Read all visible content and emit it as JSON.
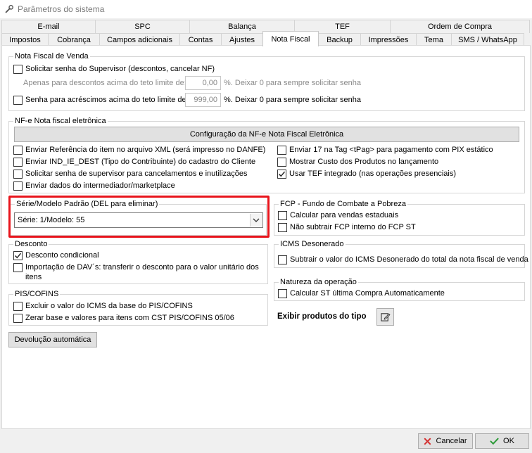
{
  "window": {
    "title": "Parâmetros do sistema"
  },
  "tabs_row1": [
    {
      "label": "E-mail"
    },
    {
      "label": "SPC"
    },
    {
      "label": "Balança"
    },
    {
      "label": "TEF"
    },
    {
      "label": "Ordem de Compra"
    }
  ],
  "tabs_row2": [
    {
      "label": "Impostos"
    },
    {
      "label": "Cobrança"
    },
    {
      "label": "Campos adicionais"
    },
    {
      "label": "Contas"
    },
    {
      "label": "Ajustes"
    },
    {
      "label": "Nota Fiscal"
    },
    {
      "label": "Backup"
    },
    {
      "label": "Impressões"
    },
    {
      "label": "Tema"
    },
    {
      "label": "SMS / WhatsApp"
    }
  ],
  "nota_fiscal_venda": {
    "legend": "Nota Fiscal de Venda",
    "solicitar_senha": "Solicitar senha do Supervisor (descontos, cancelar NF)",
    "apenas_label": "Apenas para descontos acima do teto limite de:",
    "apenas_value": "0,00",
    "apenas_suffix": "%. Deixar 0 para sempre solicitar senha",
    "senha_acrescimos": "Senha para acréscimos acima do teto limite de:",
    "senha_value": "999,00",
    "senha_suffix": "%. Deixar 0 para sempre solicitar senha"
  },
  "nfe": {
    "legend": "NF-e Nota fiscal eletrônica",
    "config_button": "Configuração da NF-e Nota Fiscal Eletrônica",
    "left": [
      {
        "label": "Enviar Referência do item no arquivo XML (será impresso no DANFE)",
        "checked": false
      },
      {
        "label": "Enviar IND_IE_DEST (Tipo do Contribuinte) do cadastro do Cliente",
        "checked": false
      },
      {
        "label": "Solicitar senha de supervisor para cancelamentos e inutilizações",
        "checked": false
      },
      {
        "label": "Enviar dados do intermediador/marketplace",
        "checked": false
      }
    ],
    "right": [
      {
        "label": "Enviar 17 na Tag <tPag> para pagamento com PIX estático",
        "checked": false
      },
      {
        "label": "Mostrar Custo dos Produtos no lançamento",
        "checked": false
      },
      {
        "label": "Usar TEF integrado (nas operações presenciais)",
        "checked": true
      }
    ]
  },
  "serie": {
    "legend": "Série/Modelo Padrão (DEL para eliminar)",
    "value": "Série: 1/Modelo: 55"
  },
  "fcp": {
    "legend": "FCP - Fundo de Combate a Pobreza",
    "items": [
      {
        "label": "Calcular para vendas estaduais",
        "checked": false
      },
      {
        "label": "Não subtrair FCP interno do FCP ST",
        "checked": false
      }
    ]
  },
  "desconto": {
    "legend": "Desconto",
    "condicional": "Desconto condicional",
    "importacao_line1": "Importação de DAV´s: transferir o desconto para o valor unitário dos",
    "importacao_line2": "itens"
  },
  "icms": {
    "legend": "ICMS Desonerado",
    "item": "Subtrair o valor do ICMS Desonerado do total da nota fiscal de venda"
  },
  "pis": {
    "legend": "PIS/COFINS",
    "items": [
      {
        "label": "Excluir o valor do ICMS da base do PIS/COFINS",
        "checked": false
      },
      {
        "label": "Zerar base e valores para itens com CST PIS/COFINS 05/06",
        "checked": false
      }
    ]
  },
  "natureza": {
    "legend": "Natureza da operação",
    "item": "Calcular ST última Compra Automaticamente"
  },
  "exibir": {
    "label": "Exibir produtos do tipo"
  },
  "devolucao": {
    "label": "Devolução automática"
  },
  "footer": {
    "cancel": "Cancelar",
    "ok": "OK"
  },
  "colors": {
    "highlight": "#e8141b",
    "cancel_icon": "#d32f2f",
    "ok_icon": "#2e9b3a"
  }
}
